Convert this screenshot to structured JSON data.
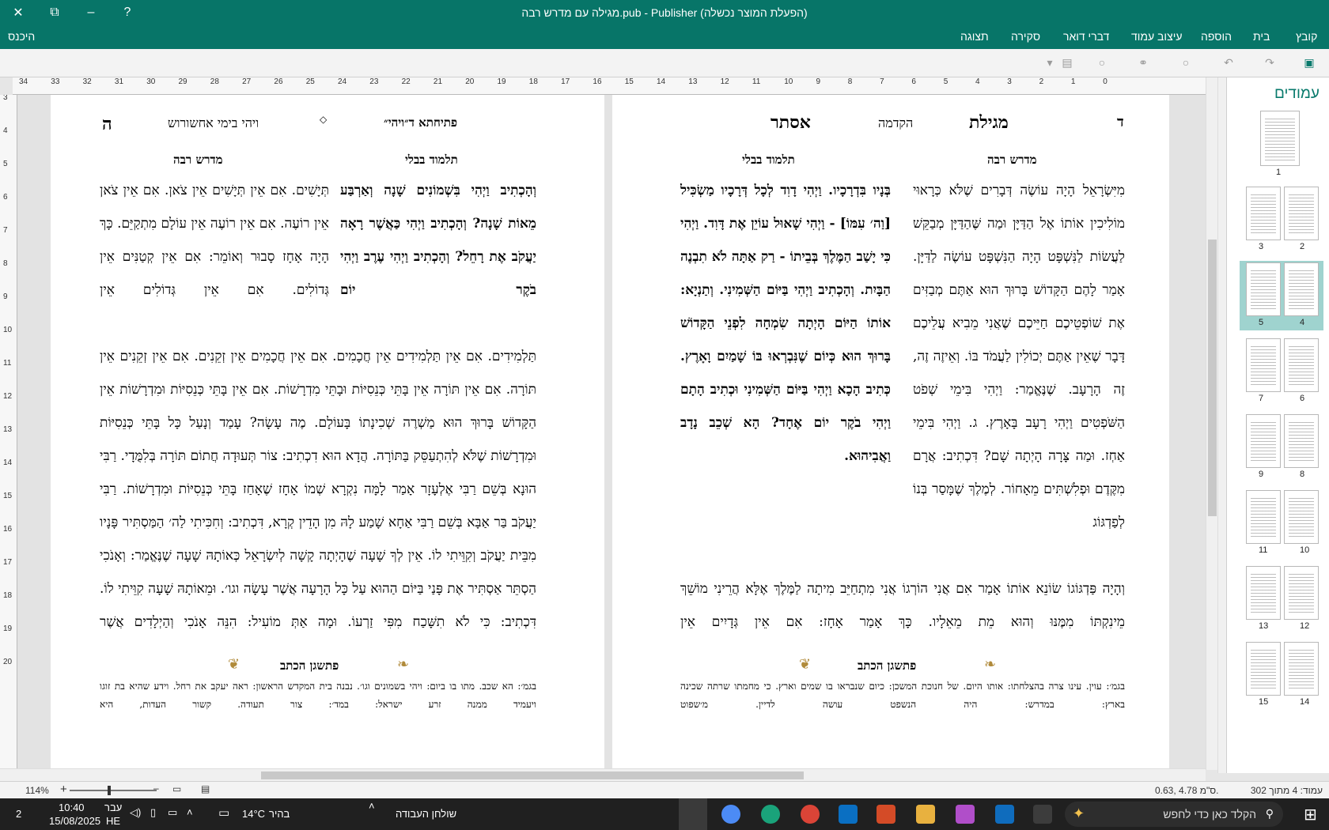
{
  "window": {
    "title": "מגילה עם מדרש רבה.pub - Publisher (הפעלת המוצר נכשלה)",
    "help": "?",
    "minimize": "–",
    "restore": "⧉",
    "close": "✕"
  },
  "ribbon": {
    "tabs": [
      "קובץ",
      "בית",
      "הוספה",
      "עיצוב עמוד",
      "דברי דואר",
      "סקירה",
      "תצוגה"
    ],
    "signin": "היכנס"
  },
  "pages_pane": {
    "title": "עמודים",
    "thumbnails": [
      "1",
      "2",
      "3",
      "4",
      "5",
      "6",
      "7",
      "8",
      "9",
      "10",
      "11",
      "12",
      "13",
      "14",
      "15"
    ]
  },
  "ruler": {
    "h_ticks": [
      "34",
      "33",
      "32",
      "31",
      "30",
      "29",
      "28",
      "27",
      "26",
      "25",
      "24",
      "23",
      "22",
      "21",
      "20",
      "19",
      "18",
      "17",
      "16",
      "15",
      "14",
      "13",
      "12",
      "11",
      "10",
      "9",
      "8",
      "7",
      "6",
      "5",
      "4",
      "3",
      "2",
      "1",
      "0"
    ],
    "v_ticks": [
      "3",
      "4",
      "5",
      "6",
      "7",
      "8",
      "9",
      "10",
      "11",
      "12",
      "13",
      "14",
      "15",
      "16",
      "17",
      "18",
      "19",
      "20"
    ]
  },
  "right_page": {
    "page_letter": "ד",
    "title_1": "מגילת",
    "title_mid": "הקדמה",
    "title_2": "אסתר",
    "col_right_head": "מדרש רבה",
    "col_left_head": "תלמוד בבלי",
    "col_right_text": "מִיִּשְׂרָאֵל הָיָה עוֹשֶׂה דְּבָרִים שֶׁלֹּא כְּרָאוּי מוֹלִיכִין אוֹתוֹ אֶל הַדַּיָּן וּמַה שֶּׁהַדַּיָּן מְבַקֵּשׁ לַעֲשׂוֹת לַנִּשְׁפָּט הָיָה הַנִּשְׁפָּט עוֹשֶׂה לַדַּיָּן. אָמַר לָהֶם הַקָּדוֹשׁ בָּרוּךְ הוּא אַתֶּם מְבַזִּים אֶת שׁוֹפְטֵיכֶם חַיֵּיכֶם שֶׁאֲנִי מֵבִיא עֲלֵיכֶם דָּבָר שֶׁאֵין אַתֶּם יְכוֹלִין לַעֲמֹד בּוֹ. וְאֵיזֶה זֶה, זֶה הָרָעָב. שֶׁנֶּאֱמַר: וַיְהִי בִּימֵי שְׁפֹט הַשֹּׁפְטִים וַיְהִי רָעָב בָּאָרֶץ. ג. וַיְהִי בִּימֵי אַחְז. וּמַה צָּרָה הָיְתָה שָׁם? דִּכְתִיב: אֲרָם מִקֶּדֶם וּפְלִשְׁתִּים מֵאָחוֹר. לְמֶלֶךְ שֶׁמָּסַר בְּנוֹ לְפַדְגּוֹג",
    "col_left_text": "בְּנָיו בִּדְרָכָיו. וַיְהִי דָוִד לְכָל דְּרָכָיו מַשְׂכִּיל [וַה׳ עִמּוֹ] - וַיְהִי שָׁאוּל עוֹיֵן אֶת דָּוִד. וַיְהִי כִּי יָשַׁב הַמֶּלֶךְ בְּבֵיתוֹ - רַק אַתָּה לֹא תִבְנֶה הַבָּיִת. וְהָכְתִיב וַיְהִי בַּיּוֹם הַשְּׁמִינִי. וְתַנְיָא: אוֹתוֹ הַיּוֹם הָיְתָה שִׂמְחָה לִפְנֵי הַקָּדוֹשׁ בָּרוּךְ הוּא כְּיוֹם שֶׁנִּבְרְאוּ בּוֹ שָׁמַיִם וָאָרֶץ. כְּתִיב הָכָא וַיְהִי בַּיּוֹם הַשְּׁמִינִי וּכְתִיב הָתָם וַיְהִי בֹקֶר יוֹם אֶחָד? הָא שְׁכֵב נָדָב וַאֲבִיהוּא.",
    "full_text": "וְהָיָה פַּדְגּוֹגוֹ שׂוֹנֵא אוֹתוֹ אָמַר אִם אֲנִי הוֹרְגוֹ אֲנִי מִתְחַיֵּב מִיתָה לַמֶּלֶךְ אֶלָּא הֲרֵינִי מוֹשֵׁךְ מֵינִקְתּוֹ מִמֶּנּוּ וְהוּא מֵת מֵאֵלָיו. כָּךְ אָמַר אָחָז: אִם אֵין גְּדָיִים אֵין",
    "footnote_title": "פתשגן הכתב",
    "footnote_text": "בגמ׳: עוין. עינו צרה בהצלחתו: אותו היום. של חנוכת המשכן: כיום שנבראו בו שמים וארץ. כי מחמתו שרתה שכינה בארץ: במדרש: היה הנשפט עושה לדיין. מ׳שפוט"
  },
  "left_page": {
    "page_letter": "ה",
    "hdr_1": "ויהי בימי אחשורוש",
    "diamond": "◇",
    "hdr_2": "פתיחתא ד״ויהי״",
    "col_right_head": "תלמוד בבלי",
    "col_left_head": "מדרש רבה",
    "col_right_text": "וְהָכְתִיב וַיְהִי בִּשְׁמוֹנִים שָׁנָה וְאַרְבַּע מֵאוֹת שָׁנָה? וְהָכְתִיב וַיְהִי כַּאֲשֶׁר רָאָה יַעֲקֹב אֶת רָחֵל? וְהָכְתִיב וַיְהִי עֶרֶב וַיְהִי בֹקֶר יוֹם",
    "col_left_text": "תְּיָשִׁים. אִם אֵין תְּיָשִׁים אֵין צֹאן. אִם אֵין צֹאן אֵין רוֹעֶה. אִם אֵין רוֹעֶה אֵין עוֹלָם מִתְקַיֵּם. כָּךְ הָיָה אָחָז סָבוּר וְאוֹמֵר: אִם אֵין קְטַנִּים אֵין גְּדוֹלִים. אִם אֵין גְּדוֹלִים אֵין",
    "full_text": "תַּלְמִידִים. אִם אֵין תַּלְמִידִים אֵין חֲכָמִים. אִם אֵין חֲכָמִים אֵין זְקֵנִים. אִם אֵין זְקֵנִים אֵין תּוֹרָה. אִם אֵין תּוֹרָה אֵין בָּתֵּי כְּנֵסִיּוֹת וּבָתֵּי מִדְרָשׁוֹת. אִם אֵין בָּתֵּי כְּנֵסִיּוֹת וּמִדְרָשׁוֹת אֵין הַקָּדוֹשׁ בָּרוּךְ הוּא מַשְׁרֶה שְׁכִינָתוֹ בָּעוֹלָם. מֶה עָשָׂה? עָמַד וְנָעַל כָּל בָּתֵּי כְּנֵסִיּוֹת וּמִדְרָשׁוֹת שֶׁלֹּא לְהִתְעַסֵּק בַּתּוֹרָה. הֲדָא הוּא דִכְתִיב: צוֹר תְּעוּדָה חֲתוֹם תּוֹרָה בְּלִמֻּדָי. רַבִּי הוּנָא בְּשֵׁם רַבִּי אֶלְעָזָר אָמַר לָמָּה נִקְרָא שְׁמוֹ אָחָז שֶׁאָחַז בָּתֵּי כְּנֵסִיּוֹת וּמִדְרָשׁוֹת. רַבִּי יַעֲקֹב בַּר אַבָּא בְּשֵׁם רַבִּי אַחָא שָׁמַע לָהּ מִן הָדֵין קְרָא, דִּכְתִיב: וְחִכִּיתִי לַה׳ הַמַּסְתִּיר פָּנָיו מִבֵּית יַעֲקֹב וְקִוֵּיתִי לוֹ. אֵין לְךָ שָׁעָה שֶׁהָיְתָה קָשָׁה לְיִשְׂרָאֵל כְּאוֹתָהּ שָׁעָה שֶׁנֶּאֱמַר: וְאָנֹכִי הַסְתֵּר אַסְתִּיר אֶת פָּנַי בַּיּוֹם הַהוּא עַל כָּל הָרָעָה אֲשֶׁר עָשָׂה וגו׳. וּמֵאוֹתָהּ שָׁעָה קִוֵּיתִי לוֹ. דִּכְתִיב: כִּי לֹא תִשָּׁכַח מִפִּי זַרְעוֹ. וּמָה אַתְּ מוֹעִיל: הִנֵּה אָנֹכִי וְהַיְלָדִים אֲשֶׁר",
    "footnote_title": "פתשגן הכתב",
    "footnote_text": "בגמ׳: הא שכב. מתו בו ביום: ויהי בשמונים וגו׳. נבנה בית המקדש הראשון: ראה יעקב את רחל. וידע שהיא בת זוגו ויעמיד ממנה זרע ישראל: במד׳: צור תעודה. קשור העדות, היא"
  },
  "status": {
    "page_info": "עמוד: 4 מתוך 302",
    "coords": "0.63, 4.78 ס\"מ.",
    "zoom": "114%"
  },
  "taskbar": {
    "search_placeholder": "הקלד כאן כדי לחפש",
    "weather_temp": "14°C",
    "weather_desc": "בהיר",
    "desk_label": "שולחן העבודה",
    "time": "10:40",
    "date": "15/08/2025",
    "lang_1": "עבר",
    "lang_2": "HE",
    "notif": "2"
  }
}
